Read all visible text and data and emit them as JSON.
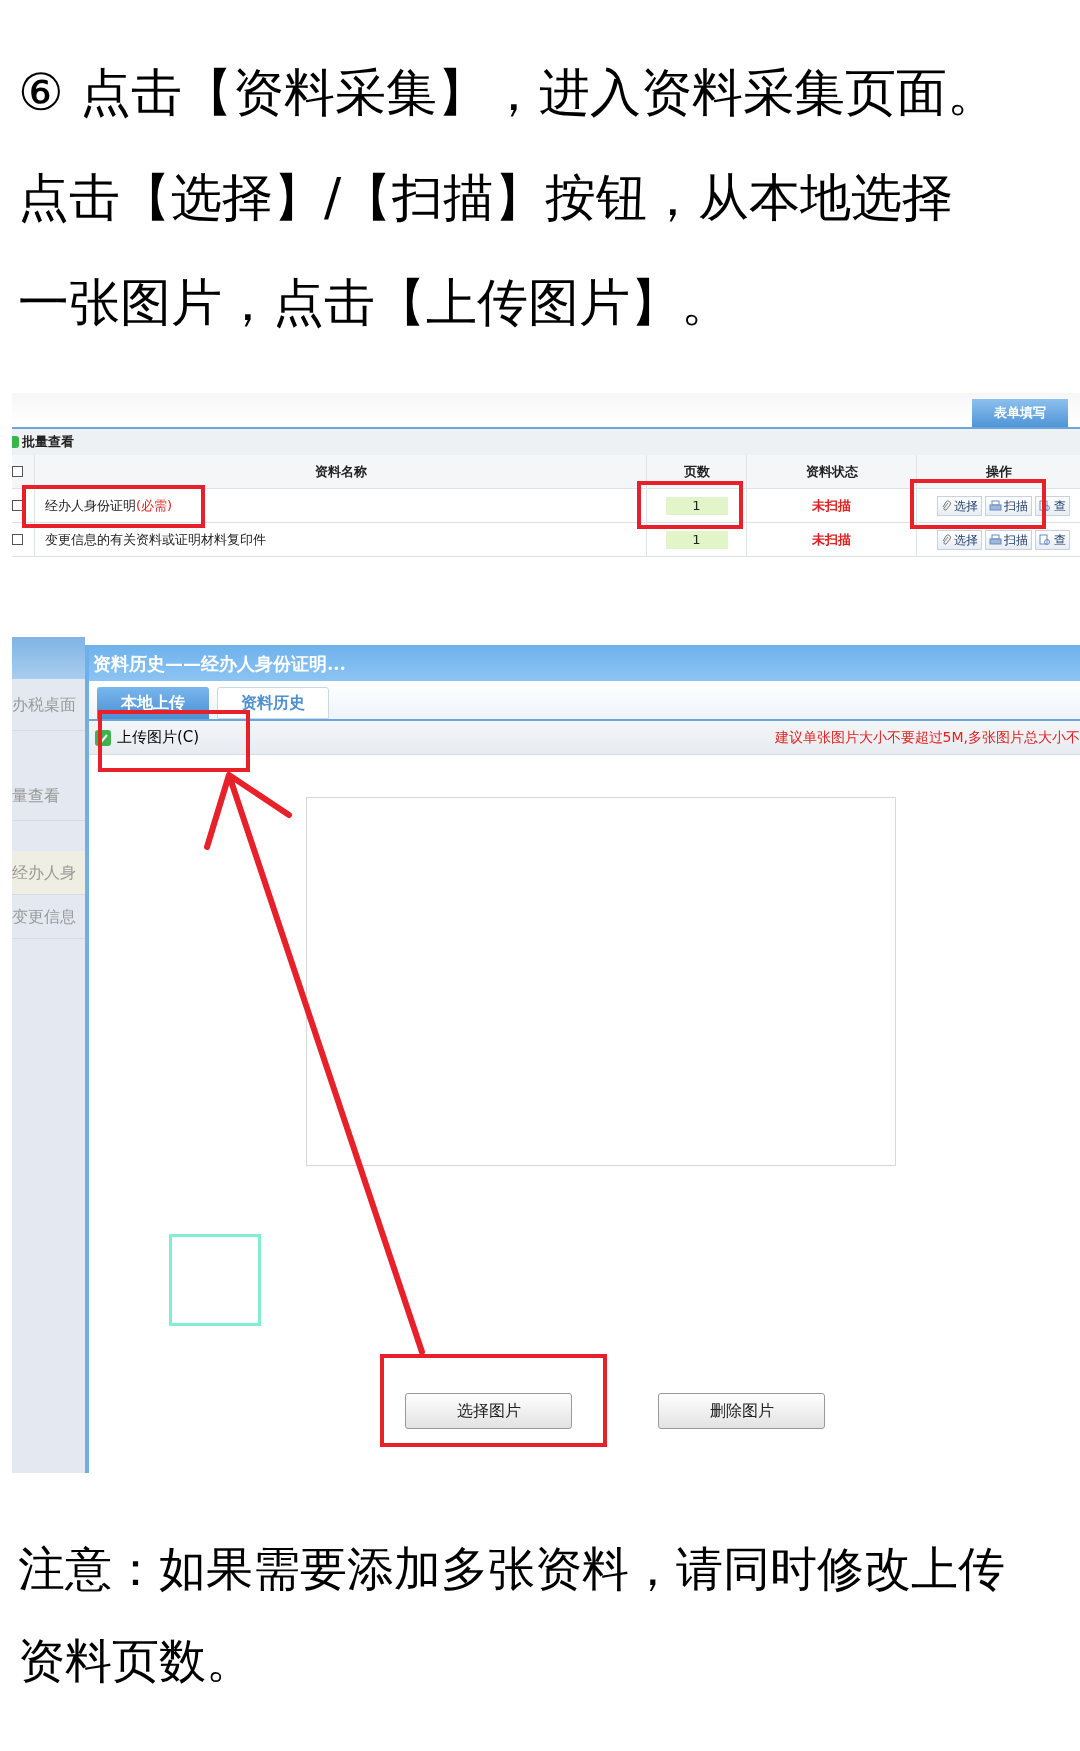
{
  "instruction": [
    "⑥ 点击【资料采集】，进入资料采集页面。",
    "点击【选择】/【扫描】按钮，从本地选择",
    "一张图片，点击【上传图片】。"
  ],
  "form_screenshot": {
    "tab": "表单填写",
    "toolbar_label": "批量查看",
    "select_all": {
      "checked": false
    },
    "columns": [
      "资料名称",
      "页数",
      "资料状态",
      "操作"
    ],
    "rows": [
      {
        "checked": false,
        "name": "经办人身份证明",
        "required_mark": "(必需)",
        "pages": "1",
        "status": "未扫描",
        "actions": [
          "选择",
          "扫描",
          "查"
        ]
      },
      {
        "checked": false,
        "name": "变更信息的有关资料或证明材料复印件",
        "pages": "1",
        "status": "未扫描",
        "actions": [
          "选择",
          "扫描",
          "查"
        ]
      }
    ]
  },
  "dialog_screenshot": {
    "sidebar": [
      "办税桌面",
      "量查看",
      "经办人身",
      "变更信息"
    ],
    "title": "资料历史——经办人身份证明...",
    "tabs": [
      {
        "label": "本地上传",
        "selected": true
      },
      {
        "label": "资料历史",
        "selected": false
      }
    ],
    "upload_option": {
      "label": "上传图片(C)",
      "checked": true
    },
    "hint": "建议单张图片大小不要超过5M,多张图片总大小不",
    "buttons": [
      "选择图片",
      "删除图片"
    ]
  },
  "note": [
    "注意：如果需要添加多张资料，请同时修改上传",
    "资料页数。"
  ]
}
